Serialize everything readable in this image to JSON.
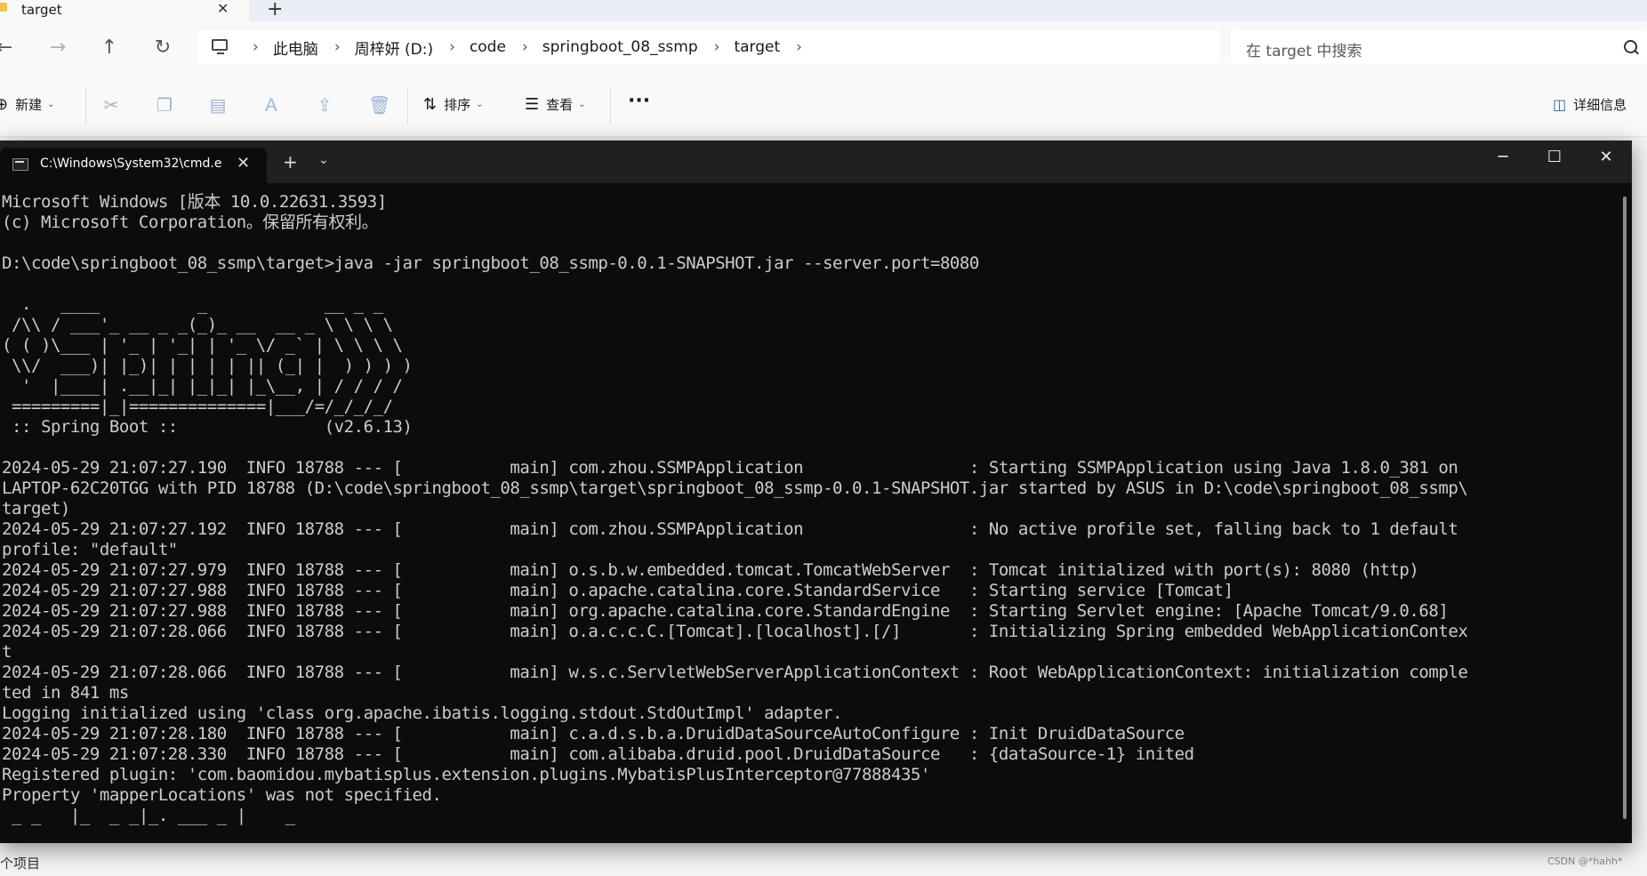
{
  "explorer": {
    "tab_title": "target",
    "address": {
      "crumbs": [
        "此电脑",
        "周梓妍 (D:)",
        "code",
        "springboot_08_ssmp",
        "target"
      ],
      "separator": "›"
    },
    "search_placeholder": "在 target 中搜索",
    "commands": {
      "new_label": "新建",
      "sort_label": "排序",
      "view_label": "查看",
      "more_label": "···",
      "details_label": "详细信息"
    },
    "status_count": "个项目",
    "watermark": "CSDN @*hahh*"
  },
  "terminal": {
    "tab_title": "C:\\Windows\\System32\\cmd.e",
    "lines": [
      "Microsoft Windows [版本 10.0.22631.3593]",
      "(c) Microsoft Corporation。保留所有权利。",
      "",
      "D:\\code\\springboot_08_ssmp\\target>java -jar springboot_08_ssmp-0.0.1-SNAPSHOT.jar --server.port=8080",
      "",
      "  .   ____          _            __ _ _",
      " /\\\\ / ___'_ __ _ _(_)_ __  __ _ \\ \\ \\ \\",
      "( ( )\\___ | '_ | '_| | '_ \\/ _` | \\ \\ \\ \\",
      " \\\\/  ___)| |_)| | | | | || (_| |  ) ) ) )",
      "  '  |____| .__|_| |_|_| |_\\__, | / / / /",
      " =========|_|==============|___/=/_/_/_/",
      " :: Spring Boot ::               (v2.6.13)",
      "",
      "2024-05-29 21:07:27.190  INFO 18788 --- [           main] com.zhou.SSMPApplication                 : Starting SSMPApplication using Java 1.8.0_381 on",
      "LAPTOP-62C20TGG with PID 18788 (D:\\code\\springboot_08_ssmp\\target\\springboot_08_ssmp-0.0.1-SNAPSHOT.jar started by ASUS in D:\\code\\springboot_08_ssmp\\",
      "target)",
      "2024-05-29 21:07:27.192  INFO 18788 --- [           main] com.zhou.SSMPApplication                 : No active profile set, falling back to 1 default",
      "profile: \"default\"",
      "2024-05-29 21:07:27.979  INFO 18788 --- [           main] o.s.b.w.embedded.tomcat.TomcatWebServer  : Tomcat initialized with port(s): 8080 (http)",
      "2024-05-29 21:07:27.988  INFO 18788 --- [           main] o.apache.catalina.core.StandardService   : Starting service [Tomcat]",
      "2024-05-29 21:07:27.988  INFO 18788 --- [           main] org.apache.catalina.core.StandardEngine  : Starting Servlet engine: [Apache Tomcat/9.0.68]",
      "2024-05-29 21:07:28.066  INFO 18788 --- [           main] o.a.c.c.C.[Tomcat].[localhost].[/]       : Initializing Spring embedded WebApplicationContex",
      "t",
      "2024-05-29 21:07:28.066  INFO 18788 --- [           main] w.s.c.ServletWebServerApplicationContext : Root WebApplicationContext: initialization comple",
      "ted in 841 ms",
      "Logging initialized using 'class org.apache.ibatis.logging.stdout.StdOutImpl' adapter.",
      "2024-05-29 21:07:28.180  INFO 18788 --- [           main] c.a.d.s.b.a.DruidDataSourceAutoConfigure : Init DruidDataSource",
      "2024-05-29 21:07:28.330  INFO 18788 --- [           main] com.alibaba.druid.pool.DruidDataSource   : {dataSource-1} inited",
      "Registered plugin: 'com.baomidou.mybatisplus.extension.plugins.MybatisPlusInterceptor@77888435'",
      "Property 'mapperLocations' was not specified.",
      " _ _   |_  _ _|_. ___ _ |    _"
    ]
  }
}
